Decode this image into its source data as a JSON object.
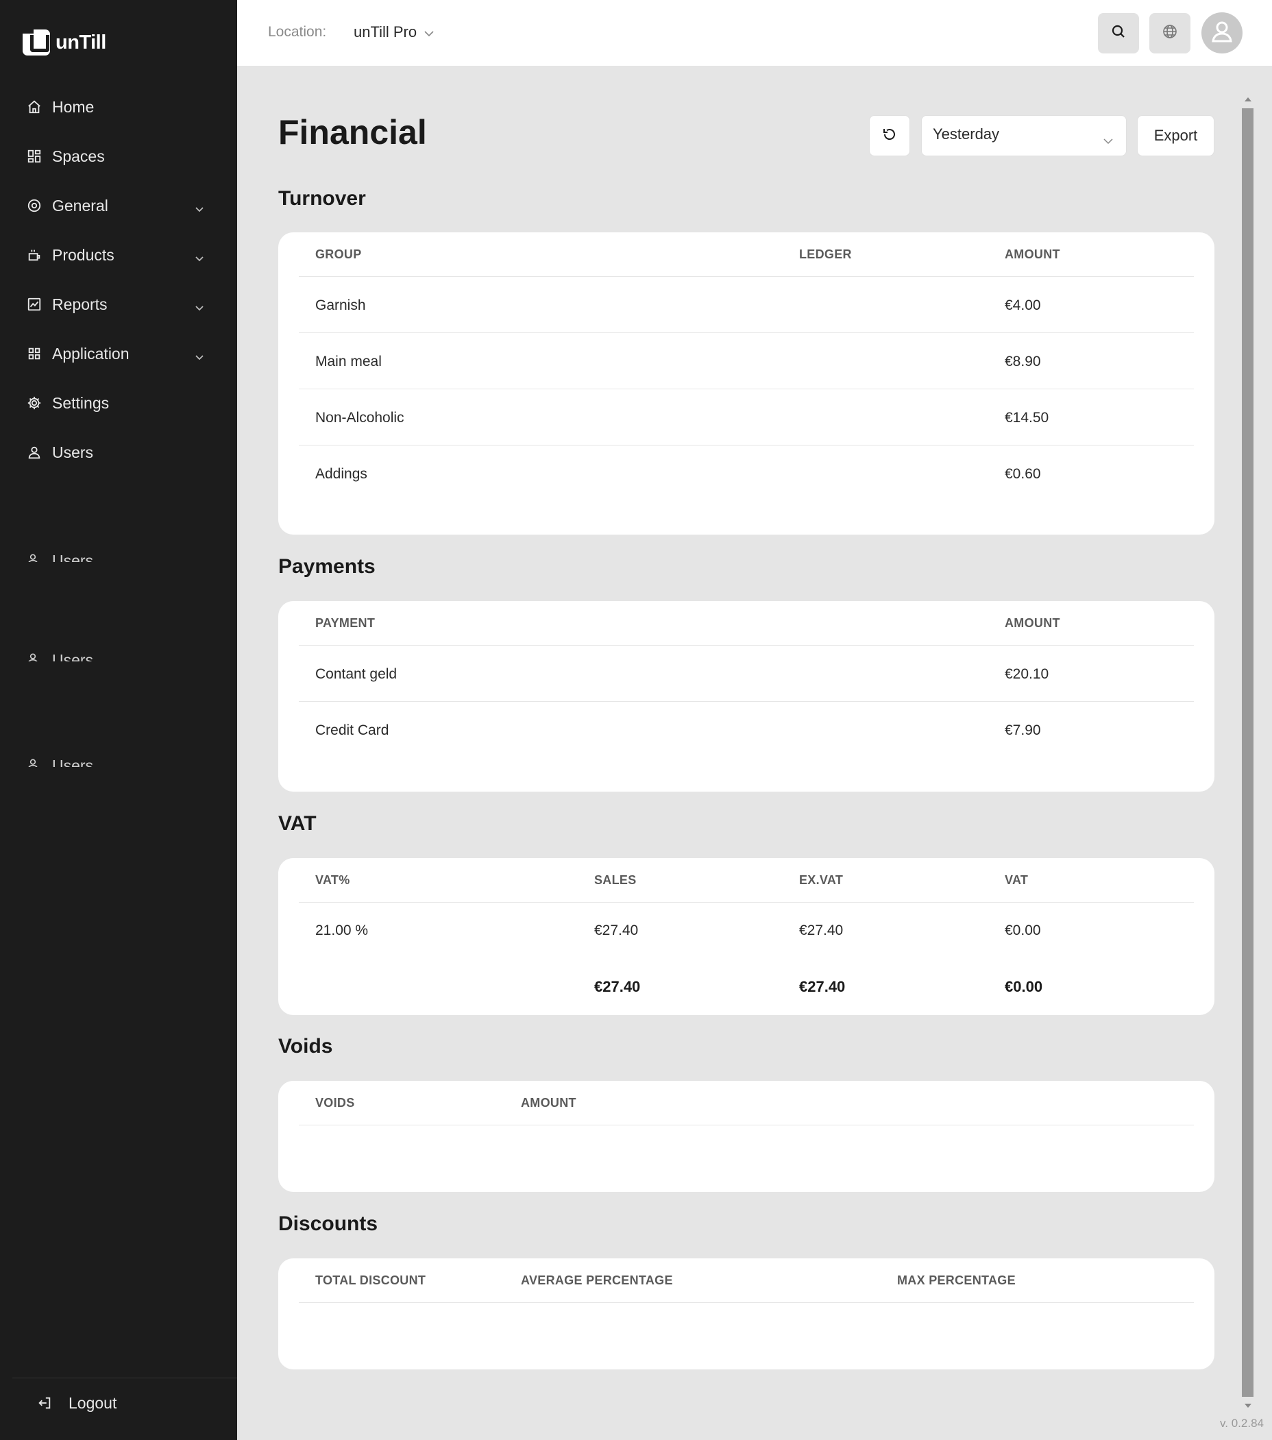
{
  "app": {
    "name": "unTill",
    "version": "v. 0.2.84"
  },
  "sidebar": {
    "items": [
      {
        "label": "Home",
        "icon": "home-icon"
      },
      {
        "label": "Spaces",
        "icon": "spaces-icon"
      },
      {
        "label": "General",
        "icon": "general-icon",
        "expandable": true
      },
      {
        "label": "Products",
        "icon": "products-icon",
        "expandable": true
      },
      {
        "label": "Reports",
        "icon": "reports-icon",
        "expandable": true
      },
      {
        "label": "Application",
        "icon": "application-icon",
        "expandable": true
      },
      {
        "label": "Settings",
        "icon": "gear-icon"
      },
      {
        "label": "Users",
        "icon": "user-icon"
      }
    ],
    "ghost_items": [
      "Users",
      "Users",
      "Users"
    ],
    "logout_label": "Logout"
  },
  "topbar": {
    "location_label": "Location:",
    "location_value": "unTill Pro"
  },
  "page": {
    "title": "Financial",
    "period": "Yesterday",
    "export_label": "Export"
  },
  "turnover": {
    "title": "Turnover",
    "headers": [
      "GROUP",
      "LEDGER",
      "AMOUNT"
    ],
    "rows": [
      {
        "group": "Garnish",
        "ledger": "",
        "amount": "€4.00"
      },
      {
        "group": "Main meal",
        "ledger": "",
        "amount": "€8.90"
      },
      {
        "group": "Non-Alcoholic",
        "ledger": "",
        "amount": "€14.50"
      },
      {
        "group": "Addings",
        "ledger": "",
        "amount": "€0.60"
      }
    ]
  },
  "payments": {
    "title": "Payments",
    "headers": [
      "PAYMENT",
      "AMOUNT"
    ],
    "rows": [
      {
        "payment": "Contant geld",
        "amount": "€20.10"
      },
      {
        "payment": "Credit Card",
        "amount": "€7.90"
      }
    ]
  },
  "vat": {
    "title": "VAT",
    "headers": [
      "VAT%",
      "SALES",
      "EX.VAT",
      "VAT"
    ],
    "rows": [
      {
        "vat_pct": "21.00 %",
        "sales": "€27.40",
        "ex_vat": "€27.40",
        "vat": "€0.00"
      }
    ],
    "totals": {
      "sales": "€27.40",
      "ex_vat": "€27.40",
      "vat": "€0.00"
    }
  },
  "voids": {
    "title": "Voids",
    "headers": [
      "VOIDS",
      "AMOUNT"
    ]
  },
  "discounts": {
    "title": "Discounts",
    "headers": [
      "TOTAL DISCOUNT",
      "AVERAGE PERCENTAGE",
      "MAX PERCENTAGE"
    ]
  }
}
